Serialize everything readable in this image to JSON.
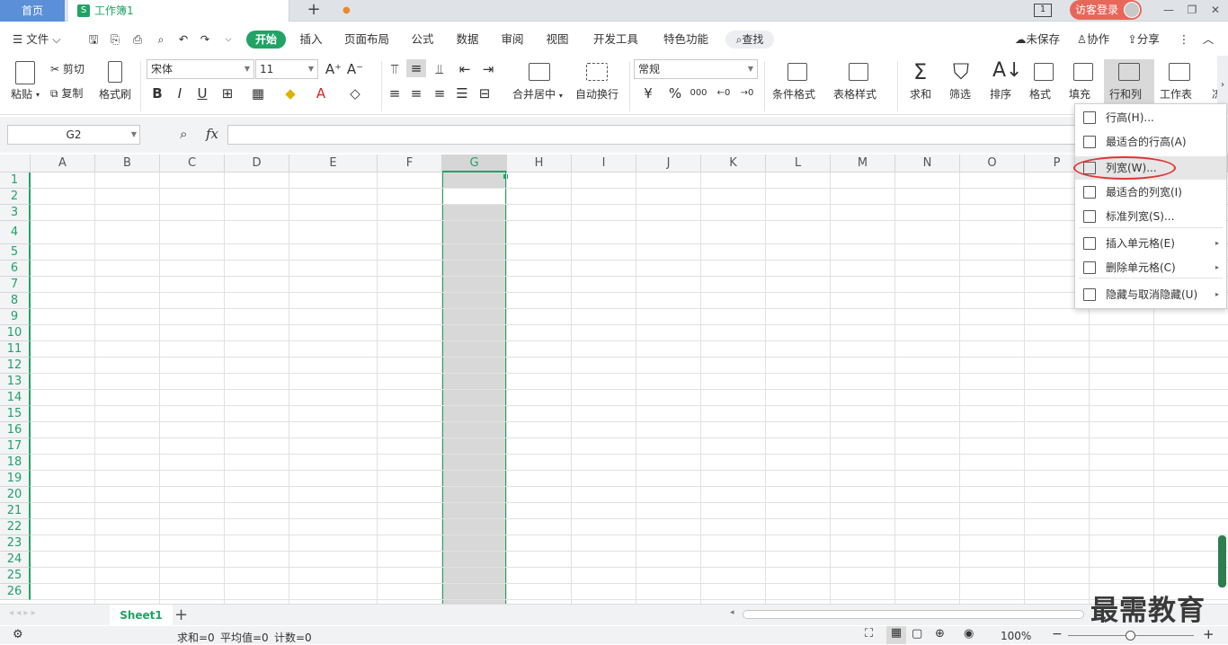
{
  "titlebar": {
    "home_tab": "首页",
    "doc_icon": "S",
    "doc_tab": "工作簿1",
    "unsaved_dot": "●",
    "new_tab": "+",
    "page_num": "1",
    "login": "访客登录"
  },
  "menu": {
    "file": "文件",
    "start": "开始",
    "insert": "插入",
    "page_layout": "页面布局",
    "formula": "公式",
    "data": "数据",
    "review": "审阅",
    "view": "视图",
    "dev_tools": "开发工具",
    "special": "特色功能",
    "find": "查找",
    "unsaved": "未保存",
    "collab": "协作",
    "share": "分享"
  },
  "ribbon": {
    "paste": "粘贴",
    "cut": "剪切",
    "copy": "复制",
    "format_painter": "格式刷",
    "font_name": "宋体",
    "font_size": "11",
    "merge_center": "合并居中",
    "auto_wrap": "自动换行",
    "number_format": "常规",
    "cond_format": "条件格式",
    "table_style": "表格样式",
    "sum": "求和",
    "filter": "筛选",
    "sort": "排序",
    "format": "格式",
    "fill": "填充",
    "row_col": "行和列",
    "worksheet": "工作表",
    "more": "冻"
  },
  "formula_bar": {
    "name_box": "G2",
    "fx": "fx",
    "formula": ""
  },
  "columns": [
    "A",
    "B",
    "C",
    "D",
    "E",
    "F",
    "G",
    "H",
    "I",
    "J",
    "K",
    "L",
    "M",
    "N",
    "O",
    "P"
  ],
  "rows": [
    "1",
    "2",
    "3",
    "4",
    "5",
    "6",
    "7",
    "8",
    "9",
    "10",
    "11",
    "12",
    "13",
    "14",
    "15",
    "16",
    "17",
    "18",
    "19",
    "20",
    "21",
    "22",
    "23",
    "24",
    "25",
    "26"
  ],
  "dropdown": [
    {
      "label": "行高(H)...",
      "icon": "row-height-icon"
    },
    {
      "label": "最适合的行高(A)",
      "icon": "autofit-row-icon"
    },
    {
      "label": "列宽(W)...",
      "icon": "column-width-icon"
    },
    {
      "label": "最适合的列宽(I)",
      "icon": "autofit-column-icon"
    },
    {
      "label": "标准列宽(S)...",
      "icon": "standard-width-icon"
    },
    {
      "label": "插入单元格(E)",
      "icon": "insert-cell-icon"
    },
    {
      "label": "删除单元格(C)",
      "icon": "delete-cell-icon"
    },
    {
      "label": "隐藏与取消隐藏(U)",
      "icon": "hide-unhide-icon"
    }
  ],
  "sheets": {
    "active": "Sheet1",
    "add": "+"
  },
  "status": {
    "sum": "求和=0",
    "avg": "平均值=0",
    "count": "计数=0",
    "zoom": "100%"
  },
  "watermark": "最需教育"
}
